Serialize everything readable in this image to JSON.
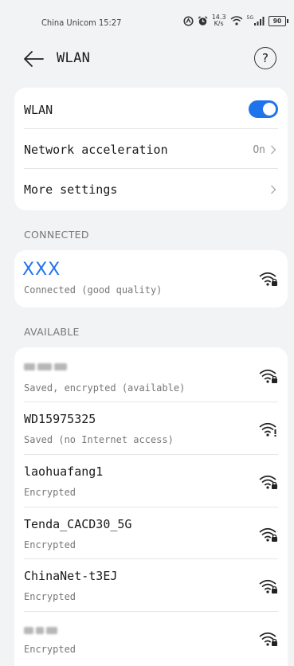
{
  "status": {
    "carrier_time": "China Unicom 15:27",
    "speed_value": "14.3",
    "speed_unit": "K/s",
    "signal_tag": "5G",
    "battery": "90"
  },
  "header": {
    "title": "WLAN",
    "help": "?"
  },
  "settings": {
    "wlan_label": "WLAN",
    "wlan_enabled": true,
    "acceleration_label": "Network acceleration",
    "acceleration_value": "On",
    "more_label": "More settings"
  },
  "sections": {
    "connected": "CONNECTED",
    "available": "AVAILABLE"
  },
  "connected_network": {
    "name": "XXX",
    "status": "Connected (good quality)"
  },
  "networks": [
    {
      "name": "",
      "status": "Saved, encrypted (available)",
      "icon": "wifi-lock-icon"
    },
    {
      "name": "WD15975325",
      "status": "Saved (no Internet access)",
      "icon": "wifi-no-internet-icon"
    },
    {
      "name": "laohuafang1",
      "status": "Encrypted",
      "icon": "wifi-lock-icon"
    },
    {
      "name": "Tenda_CACD30_5G",
      "status": "Encrypted",
      "icon": "wifi-lock-icon"
    },
    {
      "name": "ChinaNet-t3EJ",
      "status": "Encrypted",
      "icon": "wifi-lock-icon"
    },
    {
      "name": "",
      "status": "Encrypted",
      "icon": "wifi-lock-icon"
    }
  ],
  "colors": {
    "accent": "#1f74ec",
    "background": "#f1f3f5",
    "card": "#ffffff"
  }
}
